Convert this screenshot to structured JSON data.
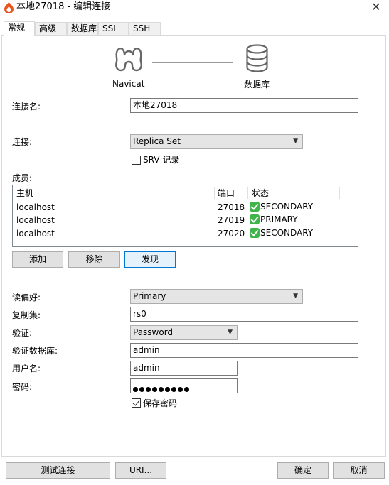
{
  "window": {
    "title": "本地27018 - 编辑连接",
    "close_glyph": "✕"
  },
  "tabs": [
    {
      "label": "常规",
      "active": true
    },
    {
      "label": "高级",
      "active": false
    },
    {
      "label": "数据库",
      "active": false
    },
    {
      "label": "SSL",
      "active": false
    },
    {
      "label": "SSH",
      "active": false
    }
  ],
  "header": {
    "client_label": "Navicat",
    "server_label": "数据库"
  },
  "form": {
    "conn_name_label": "连接名:",
    "conn_name_value": "本地27018",
    "connection_label": "连接:",
    "connection_value": "Replica Set",
    "srv_label": "SRV 记录",
    "srv_checked": false,
    "members_label": "成员:",
    "read_pref_label": "读偏好:",
    "read_pref_value": "Primary",
    "replica_set_label": "复制集:",
    "replica_set_value": "rs0",
    "auth_label": "验证:",
    "auth_value": "Password",
    "auth_db_label": "验证数据库:",
    "auth_db_value": "admin",
    "username_label": "用户名:",
    "username_value": "admin",
    "password_label": "密码:",
    "password_length": 9,
    "save_password_label": "保存密码",
    "save_password_checked": true
  },
  "members_table": {
    "headers": {
      "host": "主机",
      "port": "端口",
      "status": "状态"
    },
    "rows": [
      {
        "host": "localhost",
        "port": "27018",
        "status": "SECONDARY"
      },
      {
        "host": "localhost",
        "port": "27019",
        "status": "PRIMARY"
      },
      {
        "host": "localhost",
        "port": "27020",
        "status": "SECONDARY"
      }
    ]
  },
  "member_buttons": {
    "add": "添加",
    "remove": "移除",
    "discover": "发现"
  },
  "footer": {
    "test": "测试连接",
    "uri": "URI...",
    "ok": "确定",
    "cancel": "取消"
  },
  "colors": {
    "accent": "#0078d7",
    "status_ok": "#3fb44a",
    "app_icon": "#e8541e"
  }
}
